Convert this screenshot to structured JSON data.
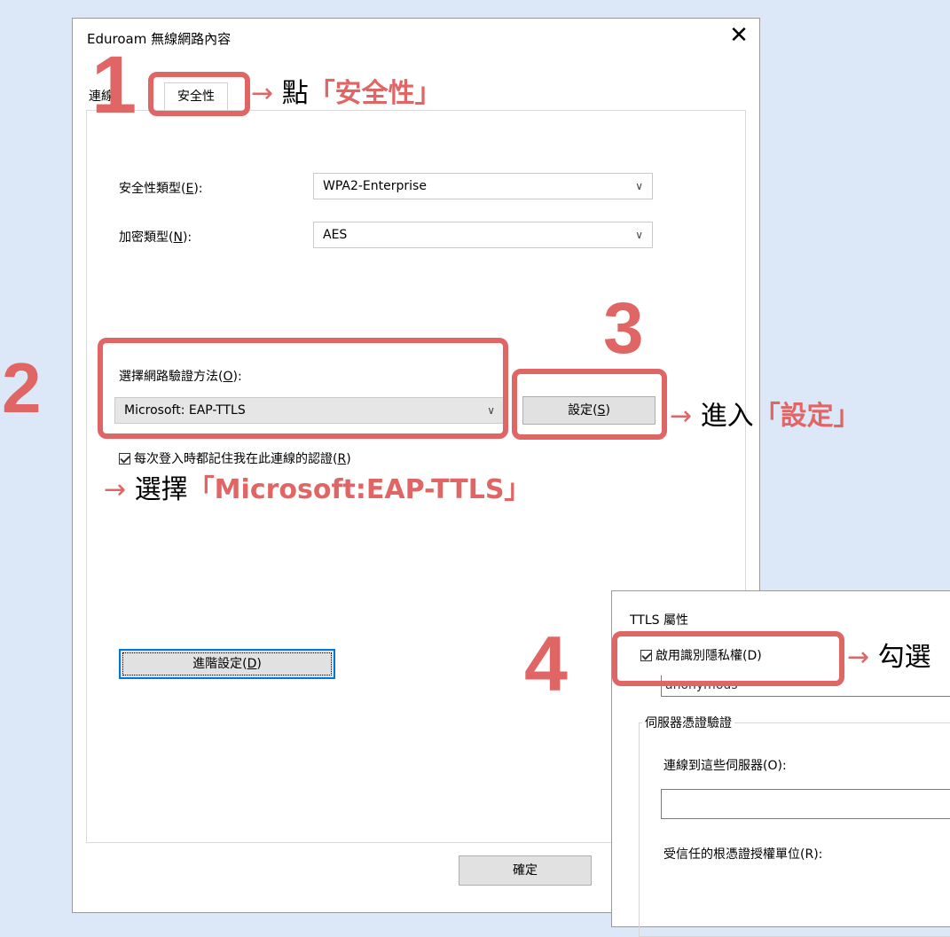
{
  "main_dialog": {
    "title": "Eduroam 無線網路內容",
    "close_glyph": "✕",
    "tabs": [
      {
        "label": "連線"
      },
      {
        "label": "安全性"
      }
    ],
    "security_type": {
      "label": "安全性類型",
      "mnemonic": "E",
      "value": "WPA2-Enterprise"
    },
    "encryption_type": {
      "label": "加密類型",
      "mnemonic": "N",
      "value": "AES"
    },
    "auth_method": {
      "label": "選擇網路驗證方法",
      "mnemonic": "O",
      "value": "Microsoft: EAP-TTLS"
    },
    "settings_button": {
      "label": "設定",
      "mnemonic": "S"
    },
    "remember_checkbox": {
      "label": "每次登入時都記住我在此連線的認證",
      "mnemonic": "R",
      "checked": true
    },
    "advanced_button": {
      "label": "進階設定",
      "mnemonic": "D"
    },
    "ok_button": {
      "label": "確定"
    }
  },
  "ttls_dialog": {
    "title": "TTLS 屬性",
    "identity_privacy": {
      "label": "啟用識別隱私權(D)",
      "checked": true
    },
    "anonymous_value": "anonymous",
    "server_cert_group": "伺服器憑證驗證",
    "connect_servers_label": "連線到這些伺服器(O):",
    "trusted_root_label": "受信任的根憑證授權單位(R):"
  },
  "annotations": {
    "step1": {
      "number": "1",
      "prefix": "點",
      "highlight": "「安全性」"
    },
    "step2": {
      "number": "2",
      "prefix": "選擇",
      "highlight": "「Microsoft:EAP-TTLS」"
    },
    "step3": {
      "number": "3",
      "prefix": "進入",
      "highlight": "「設定」"
    },
    "step4": {
      "number": "4",
      "prefix": "勾選"
    },
    "arrow_glyph": "→",
    "accent_color": "#e06666"
  }
}
